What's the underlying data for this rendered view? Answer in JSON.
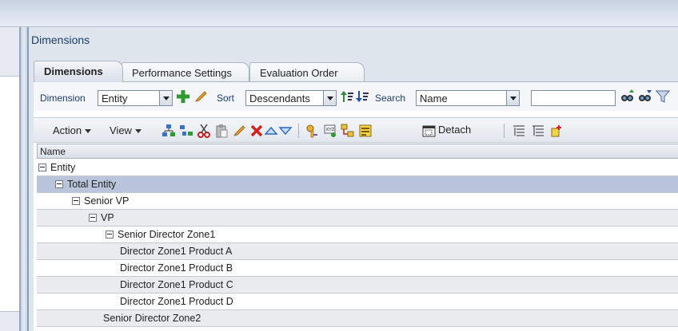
{
  "panel": {
    "title": "Dimensions"
  },
  "tabs": [
    {
      "label": "Dimensions",
      "active": true
    },
    {
      "label": "Performance Settings",
      "active": false
    },
    {
      "label": "Evaluation Order",
      "active": false
    }
  ],
  "filter": {
    "dimension_label": "Dimension",
    "dimension_value": "Entity",
    "sort_label": "Sort",
    "sort_value": "Descendants",
    "search_label": "Search",
    "search_by_value": "Name",
    "search_text": ""
  },
  "toolbar": {
    "action_label": "Action",
    "view_label": "View",
    "detach_label": "Detach"
  },
  "grid": {
    "column_header": "Name",
    "rows": [
      {
        "label": "Entity",
        "level": 0,
        "expanded": true,
        "selected": false
      },
      {
        "label": "Total Entity",
        "level": 1,
        "expanded": true,
        "selected": true
      },
      {
        "label": "Senior VP",
        "level": 2,
        "expanded": true,
        "selected": false
      },
      {
        "label": "VP",
        "level": 3,
        "expanded": true,
        "selected": false
      },
      {
        "label": "Senior Director Zone1",
        "level": 4,
        "expanded": true,
        "selected": false
      },
      {
        "label": "Director Zone1 Product A",
        "level": 5,
        "expanded": false,
        "selected": false
      },
      {
        "label": "Director Zone1 Product B",
        "level": 5,
        "expanded": false,
        "selected": false
      },
      {
        "label": "Director Zone1 Product C",
        "level": 5,
        "expanded": false,
        "selected": false
      },
      {
        "label": "Director Zone1 Product D",
        "level": 5,
        "expanded": false,
        "selected": false
      },
      {
        "label": "Senior Director Zone2",
        "level": 4,
        "expanded": false,
        "selected": false
      }
    ]
  },
  "icons": {
    "add": "add-icon",
    "edit": "edit-icon",
    "sort_up": "sort-ascending-icon",
    "sort_down": "sort-descending-icon",
    "search_prev": "search-previous-icon",
    "search_next": "search-next-icon",
    "filter": "filter-icon"
  },
  "colors": {
    "selected_row": "#b8c5db",
    "title": "#1a3f6f",
    "add_green": "#2f9a2f",
    "delete_red": "#d42020"
  }
}
